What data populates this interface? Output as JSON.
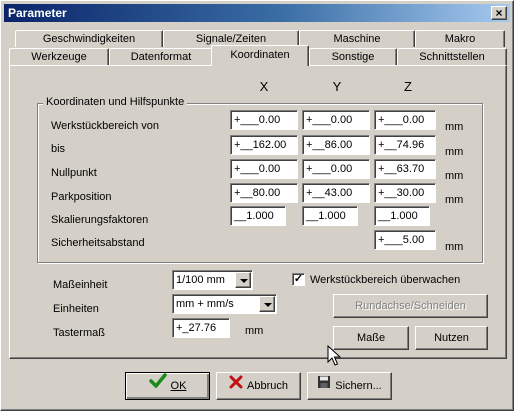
{
  "window": {
    "title": "Parameter",
    "close_label": "×"
  },
  "tabs_row1": [
    "Geschwindigkeiten",
    "Signale/Zeiten",
    "Maschine",
    "Makro"
  ],
  "tabs_row2": [
    "Werkzeuge",
    "Datenformat",
    "Koordinaten",
    "Sonstige",
    "Schnittstellen"
  ],
  "active_tab": "Koordinaten",
  "columns": {
    "x": "X",
    "y": "Y",
    "z": "Z"
  },
  "group": {
    "title": "Koordinaten und Hilfspunkte",
    "rows": [
      {
        "label": "Werkstückbereich von",
        "x": "+___0.00",
        "y": "+___0.00",
        "z": "+___0.00",
        "unit": "mm"
      },
      {
        "label": "bis",
        "x": "+__162.00",
        "y": "+__86.00",
        "z": "+__74.96",
        "unit": "mm"
      },
      {
        "label": "Nullpunkt",
        "x": "+___0.00",
        "y": "+___0.00",
        "z": "+__63.70",
        "unit": "mm"
      },
      {
        "label": "Parkposition",
        "x": "+__80.00",
        "y": "+__43.00",
        "z": "+__30.00",
        "unit": "mm"
      },
      {
        "label": "Skalierungsfaktoren",
        "x": "__1.000",
        "y": "__1.000",
        "z": "__1.000",
        "unit": ""
      },
      {
        "label": "Sicherheitsabstand",
        "z": "+___5.00",
        "unit": "mm"
      }
    ]
  },
  "masseinheit": {
    "label": "Maßeinheit",
    "value": "1/100 mm"
  },
  "einheiten": {
    "label": "Einheiten",
    "value": "mm + mm/s"
  },
  "tastermass": {
    "label": "Tastermaß",
    "value": "+_27.76",
    "unit": "mm"
  },
  "checkbox": {
    "label": "Werkstückbereich überwachen",
    "checked": true
  },
  "buttons": {
    "rundachse": "Rundachse/Schneiden",
    "masse": "Maße",
    "nutzen": "Nutzen",
    "ok": "OK",
    "abbruch": "Abbruch",
    "sichern": "Sichern..."
  }
}
